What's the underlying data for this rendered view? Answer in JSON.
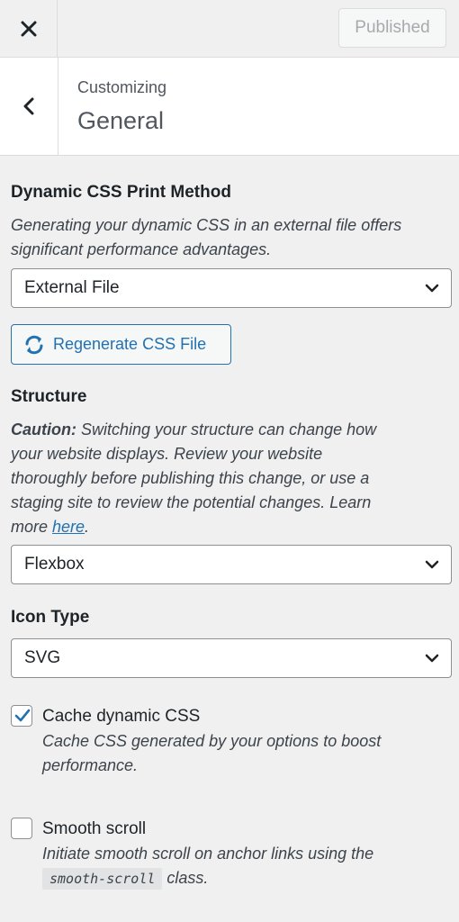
{
  "header": {
    "close_icon": "close-icon",
    "publish_label": "Published"
  },
  "section": {
    "back_icon": "chevron-left-icon",
    "breadcrumb": "Customizing",
    "title": "General"
  },
  "dynamic_css": {
    "title": "Dynamic CSS Print Method",
    "description": "Generating your dynamic CSS in an external file offers significant performance advantages.",
    "selected": "External File",
    "regen_label": "Regenerate CSS File",
    "regen_icon": "refresh-icon"
  },
  "structure": {
    "title": "Structure",
    "caution_label": "Caution:",
    "description_line1": " Switching your structure can change how",
    "description_line2": "your website displays. Review your website",
    "description_line3": "thoroughly before publishing this change, or use a",
    "description_line4": "staging site to review the potential changes. Learn",
    "description_more": "more ",
    "link_text": "here",
    "period": ".",
    "selected": "Flexbox"
  },
  "icon_type": {
    "title": "Icon Type",
    "selected": "SVG"
  },
  "cache_css": {
    "label": "Cache dynamic CSS",
    "checked": true,
    "desc_line1": "Cache CSS generated by your options to boost",
    "desc_line2": "performance."
  },
  "smooth_scroll": {
    "label": "Smooth scroll",
    "checked": false,
    "desc_line1": "Initiate smooth scroll on anchor links using the",
    "code": "smooth-scroll",
    "desc_after_code": " class."
  },
  "colors": {
    "accent": "#2271b1",
    "background": "#f0f0f1"
  }
}
